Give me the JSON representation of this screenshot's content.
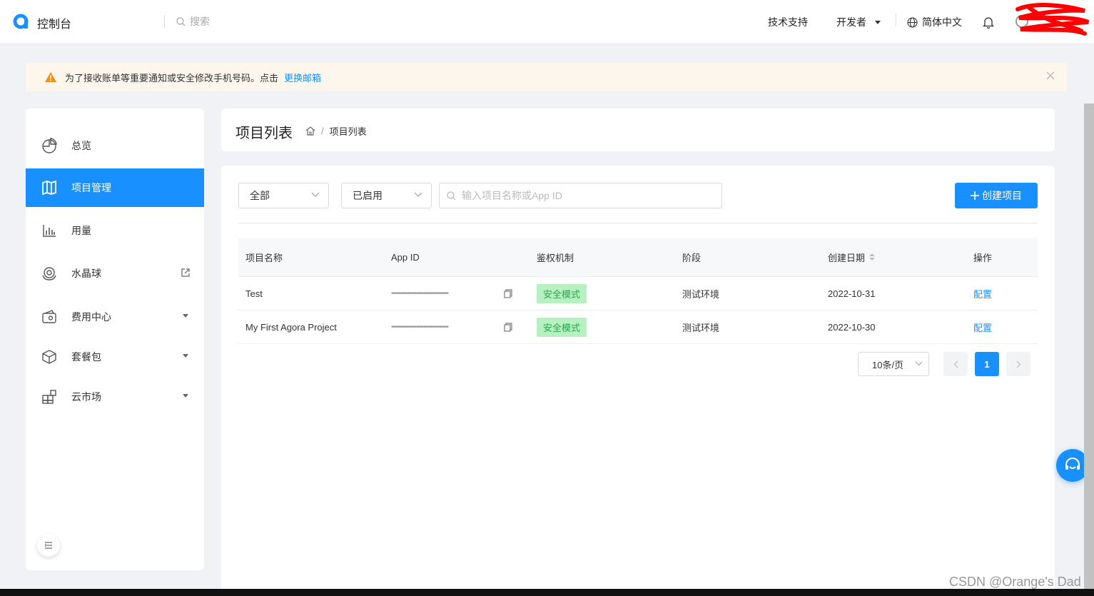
{
  "app": {
    "brand": "控制台",
    "accent": "#1890ff"
  },
  "topbar": {
    "search_placeholder": "搜索",
    "tech_support": "技术支持",
    "developer": "开发者",
    "language": "简体中文"
  },
  "notice": {
    "text": "为了接收账单等重要通知或安全修改手机号码。点击",
    "link": "更换邮箱"
  },
  "sidebar": {
    "items": [
      {
        "label": "总览",
        "icon": "pie-chart-icon"
      },
      {
        "label": "项目管理",
        "icon": "map-icon"
      },
      {
        "label": "用量",
        "icon": "bar-chart-icon"
      },
      {
        "label": "水晶球",
        "icon": "crystal-ball-icon"
      },
      {
        "label": "费用中心",
        "icon": "wallet-icon"
      },
      {
        "label": "套餐包",
        "icon": "package-icon"
      },
      {
        "label": "云市场",
        "icon": "apps-icon"
      }
    ]
  },
  "header": {
    "title": "项目列表",
    "breadcrumb_current": "项目列表"
  },
  "filters": {
    "scope": "全部",
    "status": "已启用",
    "search_placeholder": "输入项目名称或App ID",
    "create_label": "创建项目"
  },
  "table": {
    "columns": [
      "项目名称",
      "App ID",
      "鉴权机制",
      "阶段",
      "创建日期",
      "操作"
    ],
    "rows": [
      {
        "name": "Test",
        "app_id": "••••••••••••••••••••••••••••••••",
        "auth": "安全模式",
        "stage": "测试环境",
        "date": "2022-10-31",
        "action": "配置"
      },
      {
        "name": "My First Agora Project",
        "app_id": "••••••••••••••••••••••••••••••••",
        "auth": "安全模式",
        "stage": "测试环境",
        "date": "2022-10-30",
        "action": "配置"
      }
    ]
  },
  "pagination": {
    "page_size": "10条/页",
    "current_page": "1"
  },
  "watermark": "CSDN @Orange's Dad"
}
